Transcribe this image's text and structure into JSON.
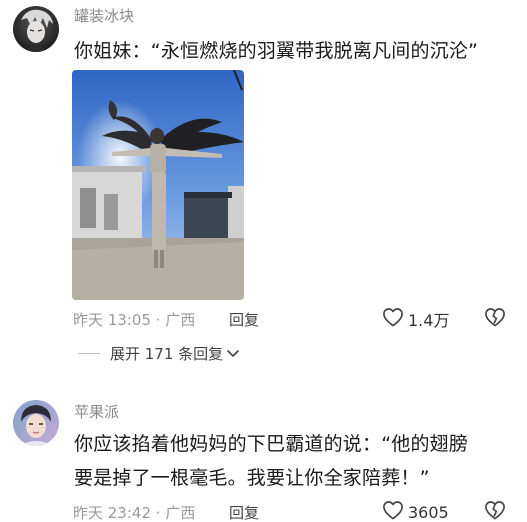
{
  "comments": [
    {
      "username": "罐装冰块",
      "text": "你姐妹：“永恒燃烧的羽翼带我脱离凡间的沉沦”",
      "time": "昨天 13:05",
      "location": "广西",
      "reply_label": "回复",
      "like_count": "1.4万"
    },
    {
      "username": "苹果派",
      "text_line1": "你应该掐着他妈妈的下巴霸道的说：“他的翅膀",
      "text_line2": "要是掉了一根毫毛。我要让你全家陪葬！”",
      "time": "昨天 23:42",
      "location": "广西",
      "reply_label": "回复",
      "like_count": "3605"
    }
  ],
  "replies_toggle": {
    "label": "展开 171 条回复"
  },
  "icons": {
    "like": "heart-outline-icon",
    "dislike": "broken-heart-icon",
    "expand": "chevron-down-icon"
  },
  "colors": {
    "text_primary": "#1a1a1a",
    "text_muted": "#9a9a9a"
  }
}
